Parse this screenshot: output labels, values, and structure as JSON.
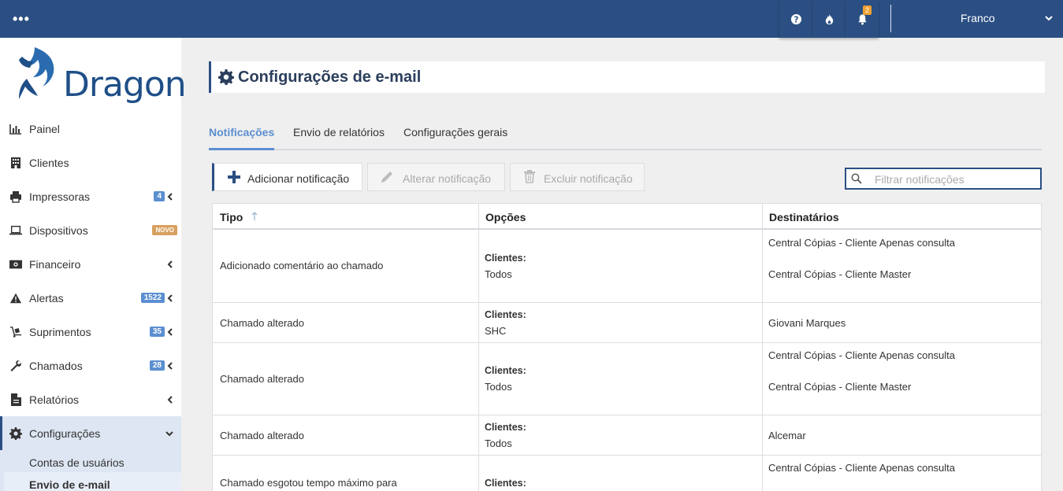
{
  "topbar": {
    "menu_dots": "•••",
    "notification_count": "2",
    "user_name": "Franco"
  },
  "brand": {
    "name": "Dragon"
  },
  "sidebar": {
    "items": [
      {
        "label": "Painel",
        "icon": "chart-icon"
      },
      {
        "label": "Clientes",
        "icon": "building-icon"
      },
      {
        "label": "Impressoras",
        "icon": "printer-icon",
        "badge": "4"
      },
      {
        "label": "Dispositivos",
        "icon": "laptop-icon",
        "badge": "NOVO"
      },
      {
        "label": "Financeiro",
        "icon": "money-icon"
      },
      {
        "label": "Alertas",
        "icon": "warning-icon",
        "badge": "1522"
      },
      {
        "label": "Suprimentos",
        "icon": "dolly-icon",
        "badge": "35"
      },
      {
        "label": "Chamados",
        "icon": "wrench-icon",
        "badge": "28"
      },
      {
        "label": "Relatórios",
        "icon": "file-icon"
      },
      {
        "label": "Configurações",
        "icon": "gear-icon"
      }
    ],
    "sub_items": [
      {
        "label": "Contas de usuários"
      },
      {
        "label": "Envio de e-mail"
      }
    ]
  },
  "page": {
    "title": "Configurações de e-mail"
  },
  "tabs": [
    {
      "label": "Notificações"
    },
    {
      "label": "Envio de relatórios"
    },
    {
      "label": "Configurações gerais"
    }
  ],
  "toolbar": {
    "add_label": "Adicionar notificação",
    "edit_label": "Alterar notificação",
    "delete_label": "Excluir notificação",
    "search_placeholder": "Filtrar notificações"
  },
  "table": {
    "headers": {
      "tipo": "Tipo",
      "opcoes": "Opções",
      "destinatarios": "Destinatários"
    },
    "rows": [
      {
        "tipo": "Adicionado comentário ao chamado",
        "opcoes_label": "Clientes:",
        "opcoes_value": "Todos",
        "destinatarios": [
          "Central Cópias - Cliente Apenas consulta",
          "Central Cópias - Cliente Master"
        ]
      },
      {
        "tipo": "Chamado alterado",
        "opcoes_label": "Clientes:",
        "opcoes_value": "SHC",
        "destinatarios": [
          "Giovani Marques"
        ]
      },
      {
        "tipo": "Chamado alterado",
        "opcoes_label": "Clientes:",
        "opcoes_value": "Todos",
        "destinatarios": [
          "Central Cópias - Cliente Apenas consulta",
          "Central Cópias - Cliente Master"
        ]
      },
      {
        "tipo": "Chamado alterado",
        "opcoes_label": "Clientes:",
        "opcoes_value": "Todos",
        "destinatarios": [
          "Alcemar"
        ]
      },
      {
        "tipo": "Chamado esgotou tempo máximo para",
        "opcoes_label": "Clientes:",
        "opcoes_value": "",
        "destinatarios": [
          "Central Cópias - Cliente Apenas consulta"
        ]
      }
    ]
  },
  "colors": {
    "primary": "#2b4f83",
    "accent": "#5b8fd0",
    "badge_new": "#d8a060",
    "notif_badge": "#f0a030"
  }
}
